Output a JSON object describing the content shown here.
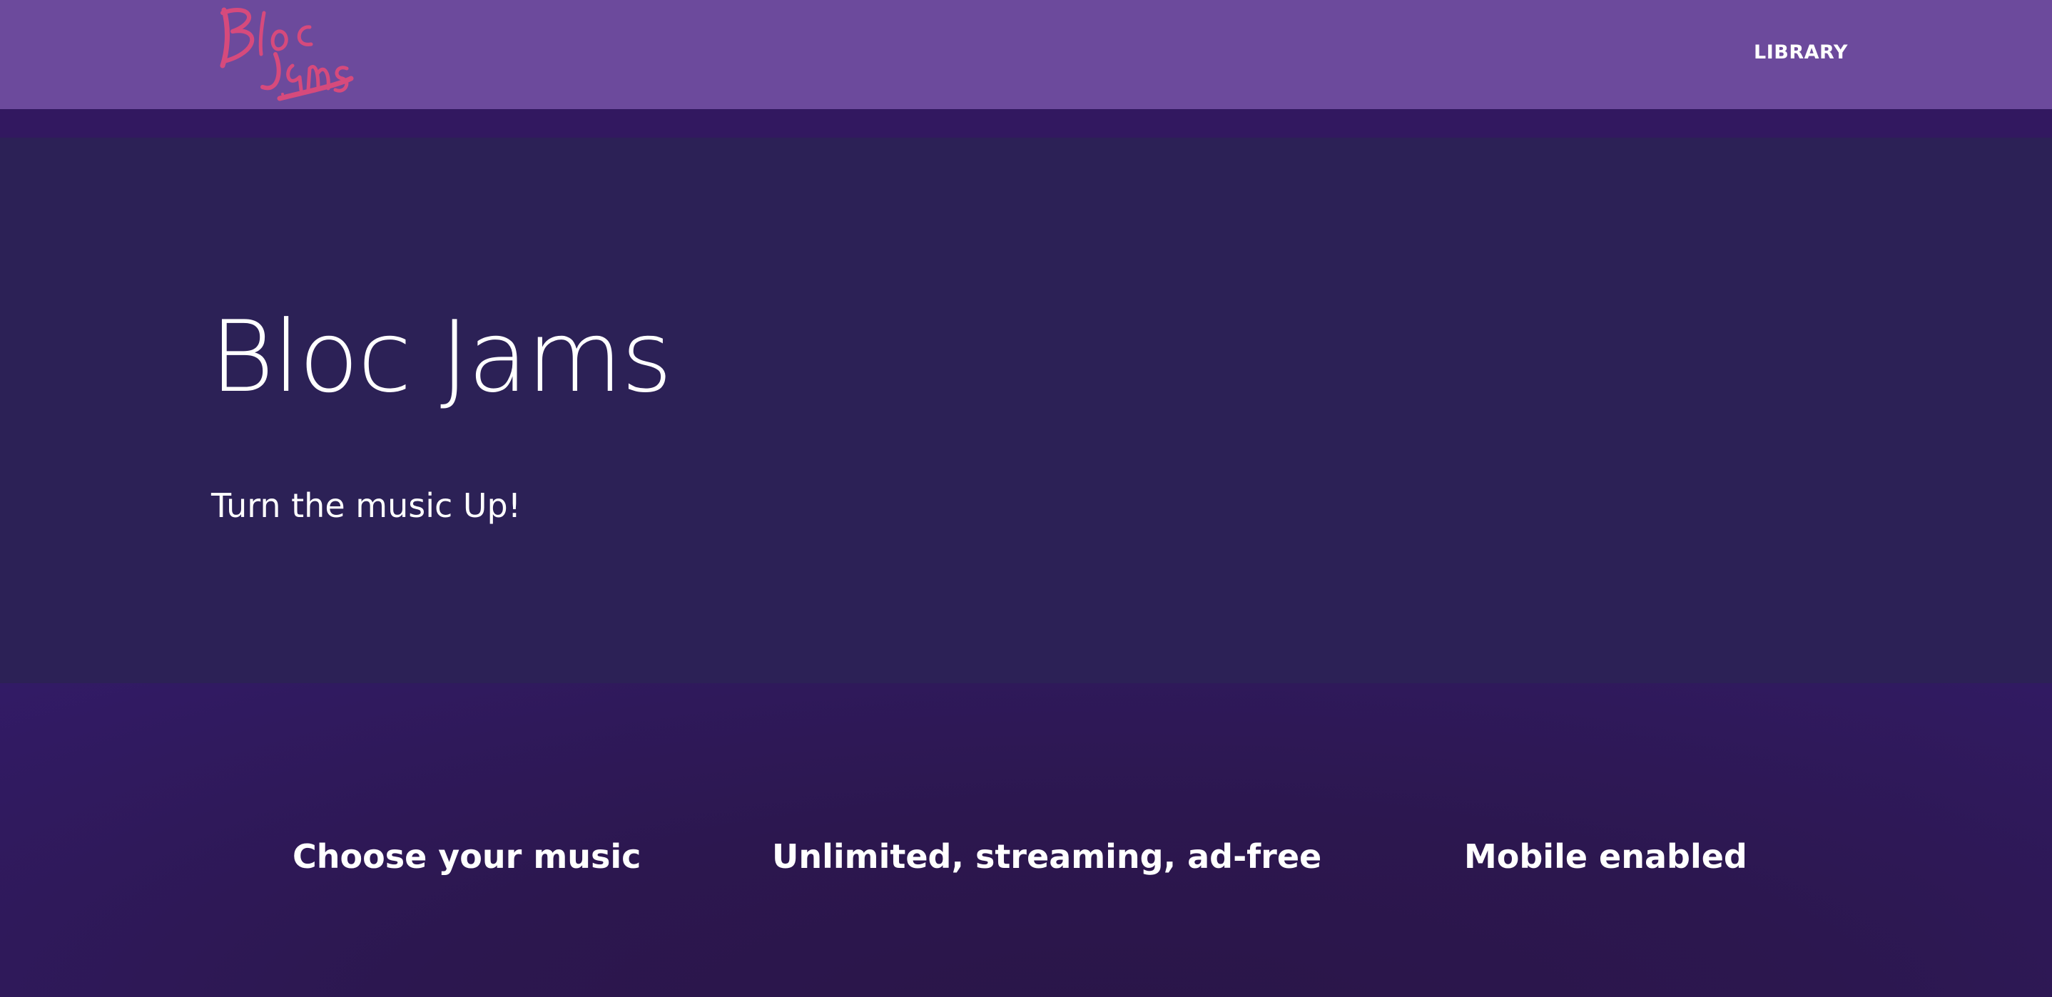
{
  "navbar": {
    "logo_alt": "Bloc Jams logo",
    "library_label": "LIBRARY"
  },
  "hero": {
    "title": "Bloc Jams",
    "subtitle": "Turn the music Up!"
  },
  "selling_points": [
    {
      "title": "Choose your music"
    },
    {
      "title": "Unlimited, streaming, ad-free"
    },
    {
      "title": "Mobile enabled"
    }
  ],
  "colors": {
    "navbar": "#6c4a9c",
    "hero": "#2c2156",
    "selling": "#2c174f",
    "logo": "#e04a7a"
  }
}
